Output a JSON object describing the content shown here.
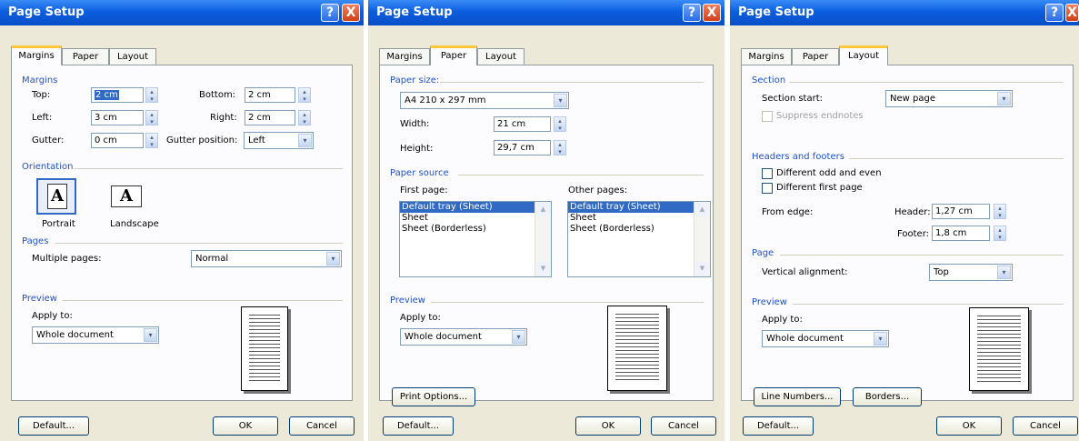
{
  "dialogs": [
    {
      "title": "Page Setup",
      "tabs": [
        "Margins",
        "Paper",
        "Layout"
      ],
      "active_tab": "Margins",
      "margins": {
        "section_title": "Margins",
        "top_label": "Top:",
        "top_value": "2 cm",
        "bottom_label": "Bottom:",
        "bottom_value": "2 cm",
        "left_label": "Left:",
        "left_value": "3 cm",
        "right_label": "Right:",
        "right_value": "2 cm",
        "gutter_label": "Gutter:",
        "gutter_value": "0 cm",
        "gutter_position_label": "Gutter position:",
        "gutter_position_value": "Left"
      },
      "orientation": {
        "section_title": "Orientation",
        "portrait_label": "Portrait",
        "landscape_label": "Landscape",
        "icon_glyph": "A"
      },
      "pages": {
        "section_title": "Pages",
        "multiple_pages_label": "Multiple pages:",
        "multiple_pages_value": "Normal"
      },
      "preview": {
        "section_title": "Preview",
        "apply_to_label": "Apply to:",
        "apply_to_value": "Whole document"
      },
      "buttons": {
        "default": "Default...",
        "ok": "OK",
        "cancel": "Cancel"
      }
    },
    {
      "title": "Page Setup",
      "tabs": [
        "Margins",
        "Paper",
        "Layout"
      ],
      "active_tab": "Paper",
      "paper_size": {
        "section_title": "Paper size:",
        "size_value": "A4 210 x 297 mm",
        "width_label": "Width:",
        "width_value": "21 cm",
        "height_label": "Height:",
        "height_value": "29,7 cm"
      },
      "paper_source": {
        "section_title": "Paper source",
        "first_page_label": "First page:",
        "other_pages_label": "Other pages:",
        "first_page_items": [
          "Default tray (Sheet)",
          "Sheet",
          "Sheet (Borderless)"
        ],
        "other_pages_items": [
          "Default tray (Sheet)",
          "Sheet",
          "Sheet (Borderless)"
        ]
      },
      "preview": {
        "section_title": "Preview",
        "apply_to_label": "Apply to:",
        "apply_to_value": "Whole document"
      },
      "print_options": "Print Options...",
      "buttons": {
        "default": "Default...",
        "ok": "OK",
        "cancel": "Cancel"
      }
    },
    {
      "title": "Page Setup",
      "tabs": [
        "Margins",
        "Paper",
        "Layout"
      ],
      "active_tab": "Layout",
      "section": {
        "section_title": "Section",
        "section_start_label": "Section start:",
        "section_start_value": "New page",
        "suppress_endnotes": "Suppress endnotes"
      },
      "headers_footers": {
        "section_title": "Headers and footers",
        "odd_even": "Different odd and even",
        "first_page": "Different first page",
        "from_edge_label": "From edge:",
        "header_label": "Header:",
        "header_value": "1,27 cm",
        "footer_label": "Footer:",
        "footer_value": "1,8 cm"
      },
      "page": {
        "section_title": "Page",
        "vertical_alignment_label": "Vertical alignment:",
        "vertical_alignment_value": "Top"
      },
      "preview": {
        "section_title": "Preview",
        "apply_to_label": "Apply to:",
        "apply_to_value": "Whole document"
      },
      "line_numbers": "Line Numbers...",
      "borders": "Borders...",
      "buttons": {
        "default": "Default...",
        "ok": "OK",
        "cancel": "Cancel"
      }
    }
  ],
  "colors": {
    "title_bar": "#0b5ee0",
    "section_heading": "#2150c5",
    "selection": "#316ac5",
    "active_tab_accent": "#ffc83c"
  },
  "icons": {
    "help": "?",
    "close": "X",
    "dropdown": "▾",
    "spin_up": "▴",
    "spin_down": "▾",
    "scroll_up": "▲",
    "scroll_down": "▼"
  }
}
